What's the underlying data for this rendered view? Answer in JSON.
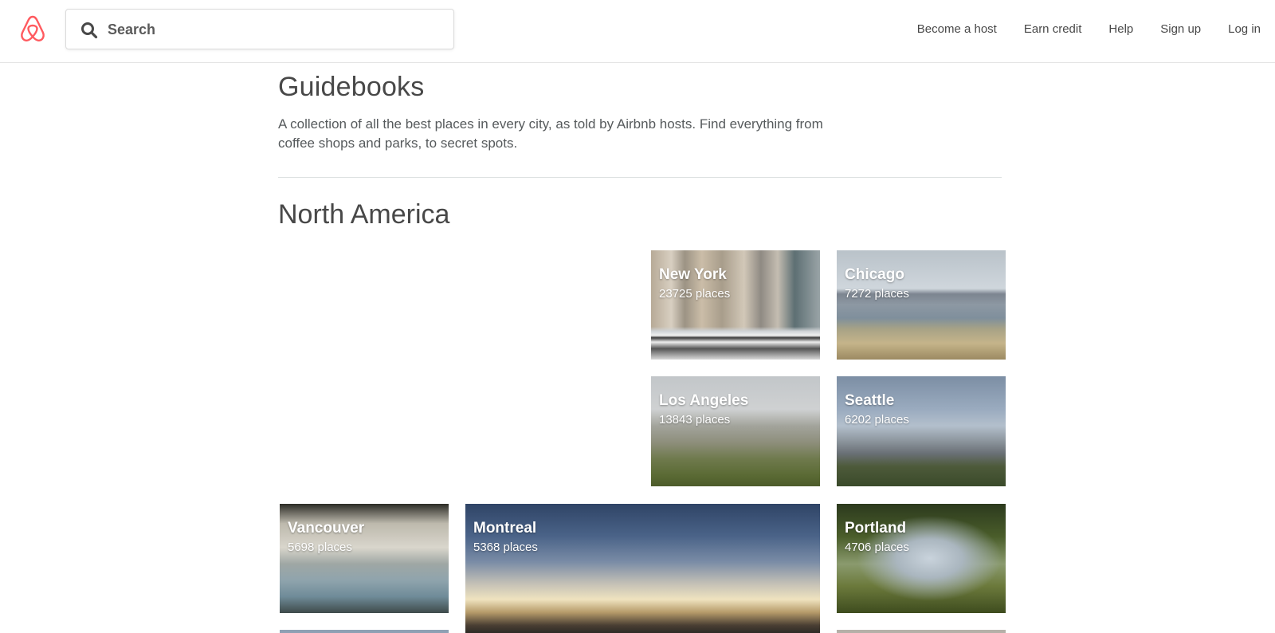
{
  "header": {
    "logo_icon": "airbnb-belo-icon",
    "brand_color": "#ff5a5f",
    "search": {
      "icon": "search-icon",
      "placeholder": "Search",
      "value": ""
    },
    "nav": [
      {
        "label": "Become a host"
      },
      {
        "label": "Earn credit"
      },
      {
        "label": "Help"
      },
      {
        "label": "Sign up"
      },
      {
        "label": "Log in"
      }
    ]
  },
  "main": {
    "title": "Guidebooks",
    "description": "A collection of all the best places in every city, as told by Airbnb hosts. Find everything from coffee shops and parks, to secret spots.",
    "section_title": "North America",
    "cities": [
      {
        "name": "New York",
        "count": "23725 places"
      },
      {
        "name": "Chicago",
        "count": "7272 places"
      },
      {
        "name": "Los Angeles",
        "count": "13843 places"
      },
      {
        "name": "Seattle",
        "count": "6202 places"
      },
      {
        "name": "Vancouver",
        "count": "5698 places"
      },
      {
        "name": "Montreal",
        "count": "5368 places"
      },
      {
        "name": "Portland",
        "count": "4706 places"
      }
    ]
  }
}
